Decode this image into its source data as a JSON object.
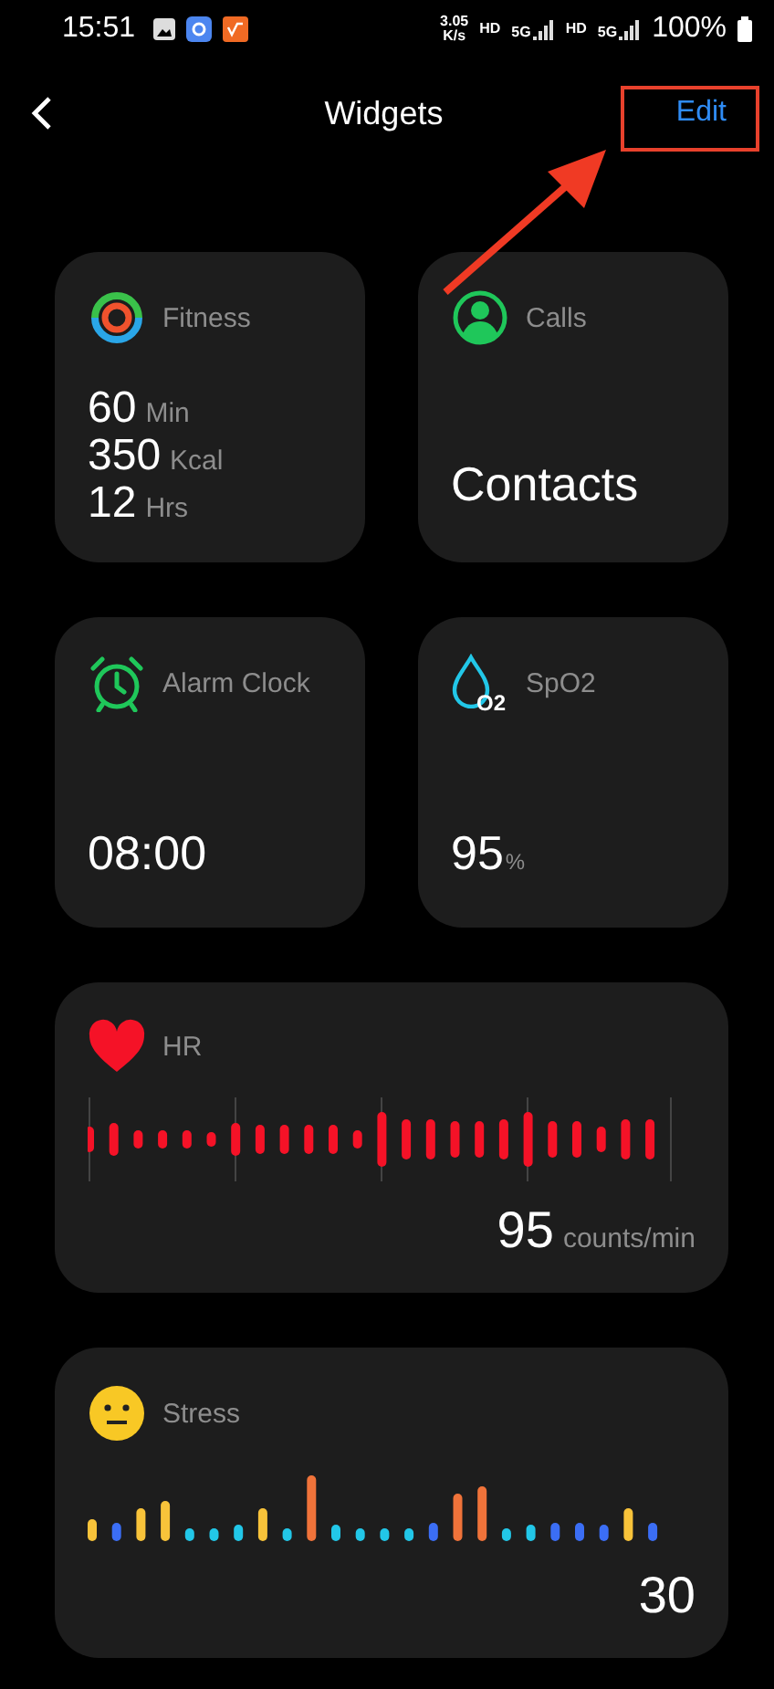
{
  "status_bar": {
    "time": "15:51",
    "speed": "3.05",
    "speed_unit": "K/s",
    "network": [
      "HD",
      "5G",
      "HD",
      "5G"
    ],
    "battery": "100%"
  },
  "header": {
    "title": "Widgets",
    "action": "Edit"
  },
  "annotation": {
    "highlight": true
  },
  "widgets": [
    {
      "kind": "fitness",
      "title": "Fitness",
      "stats": [
        {
          "value": "60",
          "unit": "Min"
        },
        {
          "value": "350",
          "unit": "Kcal"
        },
        {
          "value": "12",
          "unit": "Hrs"
        }
      ]
    },
    {
      "kind": "calls",
      "title": "Calls",
      "value": "Contacts"
    },
    {
      "kind": "alarm",
      "title": "Alarm Clock",
      "value": "08:00"
    },
    {
      "kind": "spo2",
      "title": "SpO2",
      "icon_text": "O2",
      "value": "95",
      "unit": "%"
    },
    {
      "kind": "hr",
      "title": "HR",
      "value": "95",
      "unit": "counts/min"
    },
    {
      "kind": "stress",
      "title": "Stress",
      "value": "30"
    }
  ]
}
